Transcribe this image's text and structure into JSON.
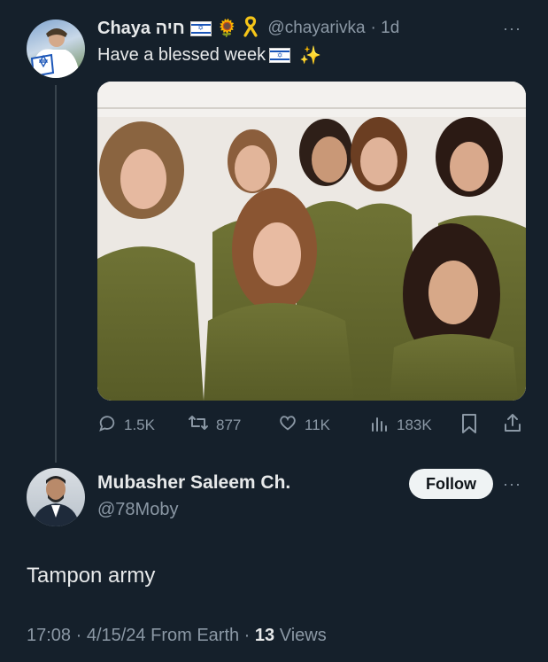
{
  "tweet": {
    "author_name": "Chaya חיה",
    "author_handle": "@chayarivka",
    "time_ago": "· 1d",
    "text": "Have a blessed week",
    "emoji_after_name_1": "🌻",
    "emoji_after_name_2": "🎗",
    "emoji_sparkles": "✨",
    "more_label": "···",
    "actions": {
      "replies": "1.5K",
      "reposts": "877",
      "likes": "11K",
      "views": "183K"
    },
    "icons": [
      "reply-icon",
      "repost-icon",
      "like-icon",
      "views-icon",
      "bookmark-icon",
      "share-icon"
    ]
  },
  "reply": {
    "author_name": "Mubasher Saleem Ch.",
    "author_handle": "@78Moby",
    "follow_label": "Follow",
    "more_label": "···",
    "text": "Tampon army",
    "timestamp": "17:08 · 4/15/24 From Earth · ",
    "views_count": "13",
    "views_label": " Views"
  },
  "colors": {
    "background": "#15202b",
    "muted": "#8b98a5",
    "text": "#e7e9ea",
    "follow_bg": "#eff3f4"
  }
}
